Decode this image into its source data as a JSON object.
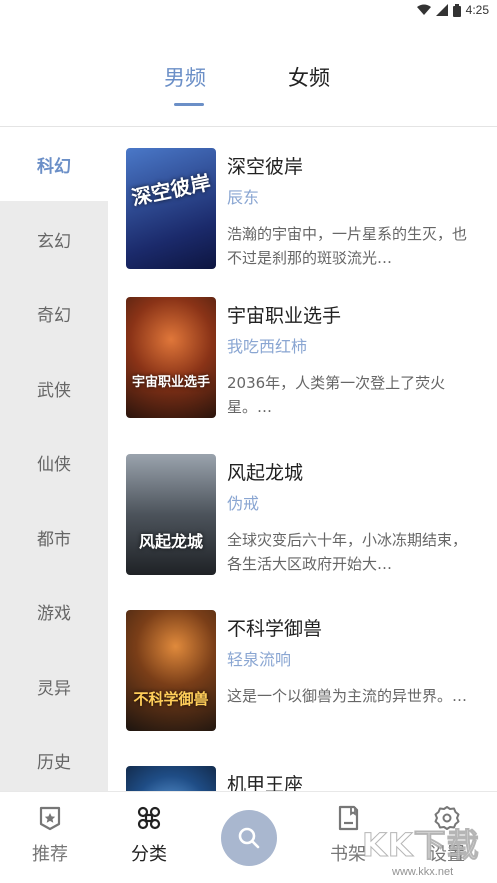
{
  "status_bar": {
    "time": "4:25",
    "icons": [
      "wifi-icon",
      "signal-icon",
      "battery-icon"
    ]
  },
  "gender_tabs": [
    {
      "label": "男频",
      "active": true
    },
    {
      "label": "女频",
      "active": false
    }
  ],
  "categories": [
    {
      "label": "科幻",
      "active": true
    },
    {
      "label": "玄幻",
      "active": false
    },
    {
      "label": "奇幻",
      "active": false
    },
    {
      "label": "武侠",
      "active": false
    },
    {
      "label": "仙侠",
      "active": false
    },
    {
      "label": "都市",
      "active": false
    },
    {
      "label": "游戏",
      "active": false
    },
    {
      "label": "灵异",
      "active": false
    },
    {
      "label": "历史",
      "active": false
    }
  ],
  "books": [
    {
      "title": "深空彼岸",
      "author": "辰东",
      "desc": "浩瀚的宇宙中，一片星系的生灭，也不过是刹那的斑驳流光…",
      "cover_text": "深空彼岸",
      "cover_colors": [
        "#1b2a6b",
        "#4a78c8"
      ]
    },
    {
      "title": "宇宙职业选手",
      "author": "我吃西红柿",
      "desc": "2036年，人类第一次登上了荧火星。…",
      "cover_text": "宇宙职业选手",
      "cover_colors": [
        "#3a1d12",
        "#c0562a"
      ]
    },
    {
      "title": "风起龙城",
      "author": "伪戒",
      "desc": "全球灾变后六十年，小冰冻期结束，各生活大区政府开始大…",
      "cover_text": "风起龙城",
      "cover_colors": [
        "#2c3036",
        "#8a9099"
      ]
    },
    {
      "title": "不科学御兽",
      "author": "轻泉流响",
      "desc": "这是一个以御兽为主流的异世界。…",
      "cover_text": "不科学御兽",
      "cover_colors": [
        "#2a2018",
        "#c9772e"
      ]
    },
    {
      "title": "机甲王座",
      "author": "",
      "desc": "",
      "cover_text": "",
      "cover_colors": [
        "#0f1d33",
        "#3f7bb8"
      ]
    }
  ],
  "bottom_nav": [
    {
      "label": "推荐",
      "icon": "badge-star-icon",
      "active": false
    },
    {
      "label": "分类",
      "icon": "command-grid-icon",
      "active": true
    },
    {
      "label": "",
      "icon": "search-icon",
      "active": false
    },
    {
      "label": "书架",
      "icon": "bookshelf-icon",
      "active": false
    },
    {
      "label": "设置",
      "icon": "gear-icon",
      "active": false
    }
  ],
  "watermark": {
    "text": "KK下载",
    "url": "www.kkx.net"
  },
  "colors": {
    "accent": "#6b8fc7",
    "author": "#8aa6d2",
    "sidebar_bg": "#ebebeb",
    "fab": "#a9b7cf"
  }
}
